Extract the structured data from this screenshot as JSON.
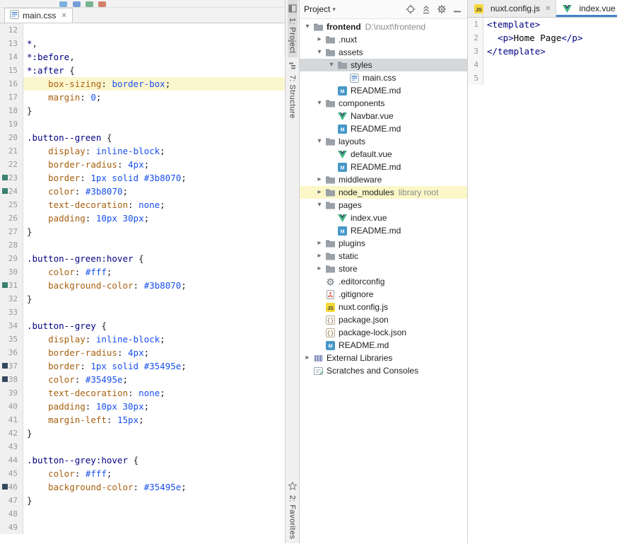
{
  "left_window": {
    "tab": {
      "label": "main.css",
      "icon": "css-file-icon"
    },
    "editor": {
      "lines": [
        {
          "n": 12,
          "t": []
        },
        {
          "n": 13,
          "t": [
            [
              "sel",
              "*"
            ],
            [
              "pun",
              ","
            ]
          ]
        },
        {
          "n": 14,
          "t": [
            [
              "sel",
              "*:before"
            ],
            [
              "pun",
              ","
            ]
          ]
        },
        {
          "n": 15,
          "t": [
            [
              "sel",
              "*:after"
            ],
            [
              "pun",
              " {"
            ]
          ]
        },
        {
          "n": 16,
          "caret": true,
          "t": [
            [
              "pln",
              "    "
            ],
            [
              "prop",
              "box-sizing"
            ],
            [
              "pun",
              ": "
            ],
            [
              "val",
              "border-box"
            ],
            [
              "pun",
              ";"
            ]
          ]
        },
        {
          "n": 17,
          "t": [
            [
              "pln",
              "    "
            ],
            [
              "prop",
              "margin"
            ],
            [
              "pun",
              ": "
            ],
            [
              "val",
              "0"
            ],
            [
              "pun",
              ";"
            ]
          ]
        },
        {
          "n": 18,
          "t": [
            [
              "pun",
              "}"
            ]
          ]
        },
        {
          "n": 19,
          "t": []
        },
        {
          "n": 20,
          "t": [
            [
              "sel",
              ".button--green"
            ],
            [
              "pun",
              " {"
            ]
          ]
        },
        {
          "n": 21,
          "t": [
            [
              "pln",
              "    "
            ],
            [
              "prop",
              "display"
            ],
            [
              "pun",
              ": "
            ],
            [
              "val",
              "inline-block"
            ],
            [
              "pun",
              ";"
            ]
          ]
        },
        {
          "n": 22,
          "t": [
            [
              "pln",
              "    "
            ],
            [
              "prop",
              "border-radius"
            ],
            [
              "pun",
              ": "
            ],
            [
              "val",
              "4px"
            ],
            [
              "pun",
              ";"
            ]
          ]
        },
        {
          "n": 23,
          "swatch": "#3b8070",
          "t": [
            [
              "pln",
              "    "
            ],
            [
              "prop",
              "border"
            ],
            [
              "pun",
              ": "
            ],
            [
              "val",
              "1px solid #3b8070"
            ],
            [
              "pun",
              ";"
            ]
          ]
        },
        {
          "n": 24,
          "swatch": "#3b8070",
          "t": [
            [
              "pln",
              "    "
            ],
            [
              "prop",
              "color"
            ],
            [
              "pun",
              ": "
            ],
            [
              "val",
              "#3b8070"
            ],
            [
              "pun",
              ";"
            ]
          ]
        },
        {
          "n": 25,
          "t": [
            [
              "pln",
              "    "
            ],
            [
              "prop",
              "text-decoration"
            ],
            [
              "pun",
              ": "
            ],
            [
              "val",
              "none"
            ],
            [
              "pun",
              ";"
            ]
          ]
        },
        {
          "n": 26,
          "t": [
            [
              "pln",
              "    "
            ],
            [
              "prop",
              "padding"
            ],
            [
              "pun",
              ": "
            ],
            [
              "val",
              "10px 30px"
            ],
            [
              "pun",
              ";"
            ]
          ]
        },
        {
          "n": 27,
          "t": [
            [
              "pun",
              "}"
            ]
          ]
        },
        {
          "n": 28,
          "t": []
        },
        {
          "n": 29,
          "t": [
            [
              "sel",
              ".button--green:hover"
            ],
            [
              "pun",
              " {"
            ]
          ]
        },
        {
          "n": 30,
          "t": [
            [
              "pln",
              "    "
            ],
            [
              "prop",
              "color"
            ],
            [
              "pun",
              ": "
            ],
            [
              "val",
              "#fff"
            ],
            [
              "pun",
              ";"
            ]
          ]
        },
        {
          "n": 31,
          "swatch": "#3b8070",
          "t": [
            [
              "pln",
              "    "
            ],
            [
              "prop",
              "background-color"
            ],
            [
              "pun",
              ": "
            ],
            [
              "val",
              "#3b8070"
            ],
            [
              "pun",
              ";"
            ]
          ]
        },
        {
          "n": 32,
          "t": [
            [
              "pun",
              "}"
            ]
          ]
        },
        {
          "n": 33,
          "t": []
        },
        {
          "n": 34,
          "t": [
            [
              "sel",
              ".button--grey"
            ],
            [
              "pun",
              " {"
            ]
          ]
        },
        {
          "n": 35,
          "t": [
            [
              "pln",
              "    "
            ],
            [
              "prop",
              "display"
            ],
            [
              "pun",
              ": "
            ],
            [
              "val",
              "inline-block"
            ],
            [
              "pun",
              ";"
            ]
          ]
        },
        {
          "n": 36,
          "t": [
            [
              "pln",
              "    "
            ],
            [
              "prop",
              "border-radius"
            ],
            [
              "pun",
              ": "
            ],
            [
              "val",
              "4px"
            ],
            [
              "pun",
              ";"
            ]
          ]
        },
        {
          "n": 37,
          "swatch": "#35495e",
          "t": [
            [
              "pln",
              "    "
            ],
            [
              "prop",
              "border"
            ],
            [
              "pun",
              ": "
            ],
            [
              "val",
              "1px solid #35495e"
            ],
            [
              "pun",
              ";"
            ]
          ]
        },
        {
          "n": 38,
          "swatch": "#35495e",
          "t": [
            [
              "pln",
              "    "
            ],
            [
              "prop",
              "color"
            ],
            [
              "pun",
              ": "
            ],
            [
              "val",
              "#35495e"
            ],
            [
              "pun",
              ";"
            ]
          ]
        },
        {
          "n": 39,
          "t": [
            [
              "pln",
              "    "
            ],
            [
              "prop",
              "text-decoration"
            ],
            [
              "pun",
              ": "
            ],
            [
              "val",
              "none"
            ],
            [
              "pun",
              ";"
            ]
          ]
        },
        {
          "n": 40,
          "t": [
            [
              "pln",
              "    "
            ],
            [
              "prop",
              "padding"
            ],
            [
              "pun",
              ": "
            ],
            [
              "val",
              "10px 30px"
            ],
            [
              "pun",
              ";"
            ]
          ]
        },
        {
          "n": 41,
          "t": [
            [
              "pln",
              "    "
            ],
            [
              "prop",
              "margin-left"
            ],
            [
              "pun",
              ": "
            ],
            [
              "val",
              "15px"
            ],
            [
              "pun",
              ";"
            ]
          ]
        },
        {
          "n": 42,
          "t": [
            [
              "pun",
              "}"
            ]
          ]
        },
        {
          "n": 43,
          "t": []
        },
        {
          "n": 44,
          "t": [
            [
              "sel",
              ".button--grey:hover"
            ],
            [
              "pun",
              " {"
            ]
          ]
        },
        {
          "n": 45,
          "t": [
            [
              "pln",
              "    "
            ],
            [
              "prop",
              "color"
            ],
            [
              "pun",
              ": "
            ],
            [
              "val",
              "#fff"
            ],
            [
              "pun",
              ";"
            ]
          ]
        },
        {
          "n": 46,
          "swatch": "#35495e",
          "t": [
            [
              "pln",
              "    "
            ],
            [
              "prop",
              "background-color"
            ],
            [
              "pun",
              ": "
            ],
            [
              "val",
              "#35495e"
            ],
            [
              "pun",
              ";"
            ]
          ]
        },
        {
          "n": 47,
          "t": [
            [
              "pun",
              "}"
            ]
          ]
        },
        {
          "n": 48,
          "t": []
        },
        {
          "n": 49,
          "t": []
        }
      ]
    }
  },
  "tool_stripe": {
    "top": [
      {
        "label": "1: Project",
        "icon": "project-tool-icon",
        "active": true
      },
      {
        "label": "7: Structure",
        "icon": "structure-tool-icon",
        "active": false
      }
    ],
    "bottom": [
      {
        "label": "2: Favorites",
        "icon": "favorites-tool-icon",
        "active": false
      }
    ]
  },
  "project_panel": {
    "title": "Project",
    "header_icons": [
      "locate-icon",
      "collapse-all-icon",
      "settings-gear-icon",
      "hide-icon"
    ],
    "tree": [
      {
        "indent": 0,
        "arrow": "expanded",
        "icon": "folder-icon",
        "label": "frontend",
        "bold": true,
        "secondary": "D:\\nuxt\\frontend"
      },
      {
        "indent": 1,
        "arrow": "collapsed",
        "icon": "folder-icon",
        "label": ".nuxt"
      },
      {
        "indent": 1,
        "arrow": "expanded",
        "icon": "folder-icon",
        "label": "assets"
      },
      {
        "indent": 2,
        "arrow": "expanded",
        "icon": "folder-icon",
        "label": "styles",
        "state": "selected"
      },
      {
        "indent": 3,
        "arrow": "none",
        "icon": "css-file-icon",
        "label": "main.css"
      },
      {
        "indent": 2,
        "arrow": "none",
        "icon": "markdown-file-icon",
        "label": "README.md"
      },
      {
        "indent": 1,
        "arrow": "expanded",
        "icon": "folder-icon",
        "label": "components"
      },
      {
        "indent": 2,
        "arrow": "none",
        "icon": "vue-file-icon",
        "label": "Navbar.vue"
      },
      {
        "indent": 2,
        "arrow": "none",
        "icon": "markdown-file-icon",
        "label": "README.md"
      },
      {
        "indent": 1,
        "arrow": "expanded",
        "icon": "folder-icon",
        "label": "layouts"
      },
      {
        "indent": 2,
        "arrow": "none",
        "icon": "vue-file-icon",
        "label": "default.vue"
      },
      {
        "indent": 2,
        "arrow": "none",
        "icon": "markdown-file-icon",
        "label": "README.md"
      },
      {
        "indent": 1,
        "arrow": "collapsed",
        "icon": "folder-icon",
        "label": "middleware"
      },
      {
        "indent": 1,
        "arrow": "collapsed",
        "icon": "folder-icon",
        "label": "node_modules",
        "secondary": "library root",
        "state": "highlighted"
      },
      {
        "indent": 1,
        "arrow": "expanded",
        "icon": "folder-icon",
        "label": "pages"
      },
      {
        "indent": 2,
        "arrow": "none",
        "icon": "vue-file-icon",
        "label": "index.vue"
      },
      {
        "indent": 2,
        "arrow": "none",
        "icon": "markdown-file-icon",
        "label": "README.md"
      },
      {
        "indent": 1,
        "arrow": "collapsed",
        "icon": "folder-icon",
        "label": "plugins"
      },
      {
        "indent": 1,
        "arrow": "collapsed",
        "icon": "folder-icon",
        "label": "static"
      },
      {
        "indent": 1,
        "arrow": "collapsed",
        "icon": "folder-icon",
        "label": "store"
      },
      {
        "indent": 1,
        "arrow": "none",
        "icon": "editorconfig-file-icon",
        "label": ".editorconfig"
      },
      {
        "indent": 1,
        "arrow": "none",
        "icon": "git-file-icon",
        "label": ".gitignore"
      },
      {
        "indent": 1,
        "arrow": "none",
        "icon": "js-file-icon",
        "label": "nuxt.config.js"
      },
      {
        "indent": 1,
        "arrow": "none",
        "icon": "json-file-icon",
        "label": "package.json"
      },
      {
        "indent": 1,
        "arrow": "none",
        "icon": "json-file-icon",
        "label": "package-lock.json"
      },
      {
        "indent": 1,
        "arrow": "none",
        "icon": "markdown-file-icon",
        "label": "README.md"
      },
      {
        "indent": 0,
        "arrow": "collapsed",
        "icon": "libraries-icon",
        "label": "External Libraries"
      },
      {
        "indent": 0,
        "arrow": "none",
        "icon": "scratches-icon",
        "label": "Scratches and Consoles"
      }
    ]
  },
  "right_window": {
    "tabs": [
      {
        "label": "nuxt.config.js",
        "icon": "js-file-icon",
        "selected": false
      },
      {
        "label": "index.vue",
        "icon": "vue-file-icon",
        "selected": true
      }
    ],
    "editor": {
      "lines": [
        {
          "n": 1,
          "t": [
            [
              "tag",
              "<template>"
            ]
          ]
        },
        {
          "n": 2,
          "t": [
            [
              "pln",
              "  "
            ],
            [
              "tag",
              "<p>"
            ],
            [
              "pln",
              "Home Page"
            ],
            [
              "tag",
              "</p>"
            ]
          ]
        },
        {
          "n": 3,
          "t": [
            [
              "tag",
              "</template>"
            ]
          ]
        },
        {
          "n": 4,
          "t": []
        },
        {
          "n": 5,
          "t": []
        }
      ]
    }
  },
  "colors": {
    "accent_tab_underline": "#4083c9",
    "selection_unfocused": "#d4d8db",
    "library_root_highlight": "#fbf7c8",
    "caret_row": "#fcf6cf",
    "swatch_green": "#3b8070",
    "swatch_navy": "#35495e"
  }
}
